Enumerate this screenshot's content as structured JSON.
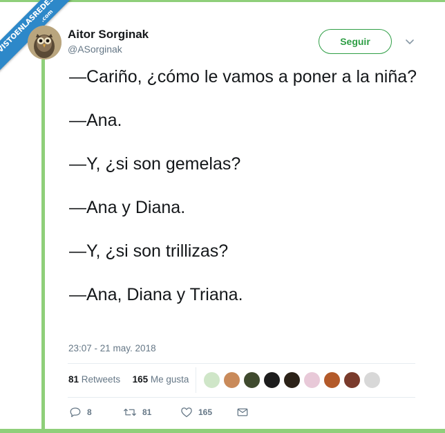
{
  "watermark": {
    "line1": "VISTOENLASREDES",
    "line2": ".com",
    "color": "#2d88c9"
  },
  "author": {
    "name": "Aitor Sorginak",
    "handle": "@ASorginak"
  },
  "follow_button": {
    "label": "Seguir",
    "color": "#2e9e45"
  },
  "tweet": {
    "lines": [
      "—Cariño, ¿cómo le vamos a poner a la niña?",
      "—Ana.",
      "—Y, ¿si son gemelas?",
      "—Ana y Diana.",
      "—Y, ¿si son trillizas?",
      "—Ana, Diana y Triana."
    ],
    "timestamp": "23:07 - 21 may. 2018"
  },
  "stats": {
    "retweets_count": "81",
    "retweets_label": "Retweets",
    "likes_count": "165",
    "likes_label": "Me gusta"
  },
  "likers": [
    {
      "icon": "liker-avatar-1",
      "color": "#cfe6c8"
    },
    {
      "icon": "liker-avatar-2",
      "color": "#c98a5a"
    },
    {
      "icon": "liker-avatar-3",
      "color": "#3f4a2e"
    },
    {
      "icon": "liker-avatar-4",
      "color": "#1d1d1d"
    },
    {
      "icon": "liker-avatar-5",
      "color": "#2b2218"
    },
    {
      "icon": "liker-avatar-6",
      "color": "#e8c9d8"
    },
    {
      "icon": "liker-avatar-7",
      "color": "#b35a2a"
    },
    {
      "icon": "liker-avatar-8",
      "color": "#7a3b2c"
    },
    {
      "icon": "liker-avatar-9",
      "color": "#d8d8d8"
    }
  ],
  "actions": {
    "reply_count": "8",
    "retweet_count": "81",
    "like_count": "165"
  }
}
